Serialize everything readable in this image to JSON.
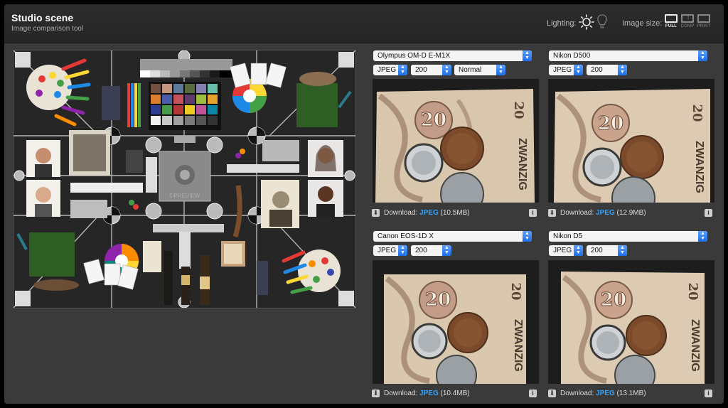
{
  "header": {
    "title": "Studio scene",
    "subtitle": "Image comparison tool",
    "lighting_label": "Lighting:",
    "image_size_label": "Image size:",
    "size_options": [
      {
        "label": "FULL",
        "active": true
      },
      {
        "label": "COMP",
        "active": false
      },
      {
        "label": "PRINT",
        "active": false
      }
    ]
  },
  "scene": {
    "chart_text": "DPREVIEW"
  },
  "panels": [
    {
      "camera": "Olympus OM-D E-M1X",
      "format": "JPEG",
      "iso": "200",
      "mode": "Normal",
      "download_label": "Download:",
      "download_format": "JPEG",
      "download_size": "(10.5MB)"
    },
    {
      "camera": "Nikon D500",
      "format": "JPEG",
      "iso": "200",
      "download_label": "Download:",
      "download_format": "JPEG",
      "download_size": "(12.9MB)"
    },
    {
      "camera": "Canon EOS-1D X",
      "format": "JPEG",
      "iso": "200",
      "download_label": "Download:",
      "download_format": "JPEG",
      "download_size": "(10.4MB)"
    },
    {
      "camera": "Nikon D5",
      "format": "JPEG",
      "iso": "200",
      "download_label": "Download:",
      "download_format": "JPEG",
      "download_size": "(13.1MB)"
    }
  ],
  "banknote": {
    "denomination": "20",
    "word": "ZWANZIG"
  },
  "colors": {
    "accent": "#2fa3ff",
    "panel_bg": "#3a3a3a",
    "header_bg": "#2a2a2a"
  }
}
